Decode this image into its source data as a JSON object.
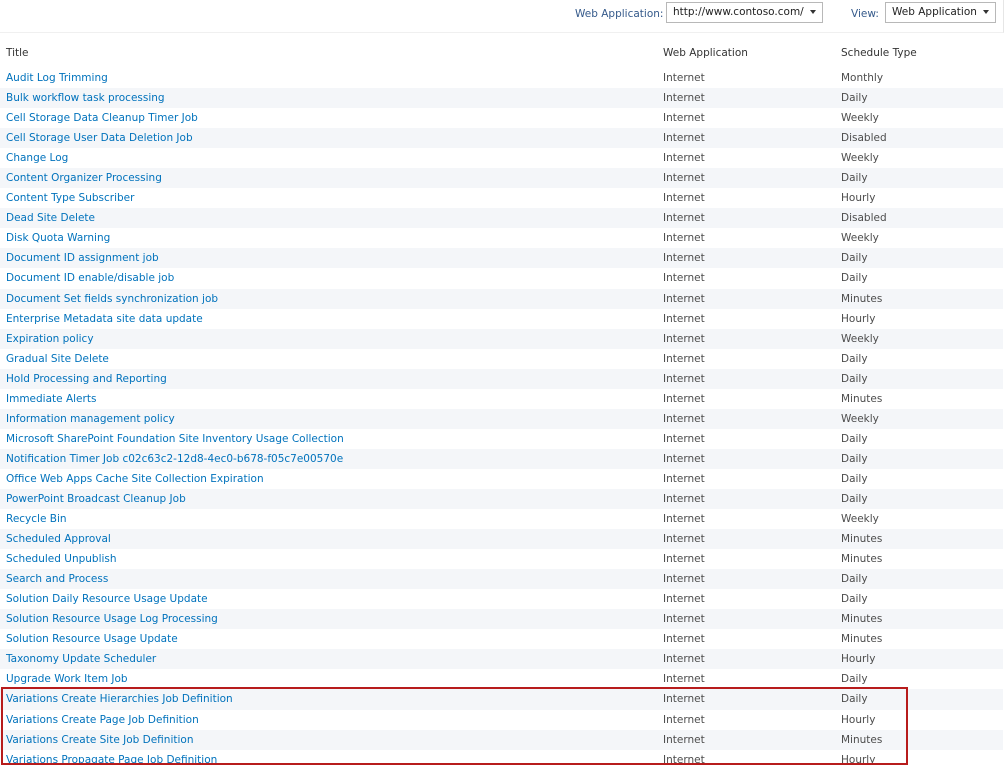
{
  "toolbar": {
    "web_application_label": "Web Application:",
    "web_application_value": "http://www.contoso.com/",
    "view_label": "View:",
    "view_value": "Web Application"
  },
  "table": {
    "columns": [
      "Title",
      "Web Application",
      "Schedule Type"
    ],
    "rows": [
      {
        "title": "Audit Log Trimming",
        "web_application": "Internet",
        "schedule_type": "Monthly"
      },
      {
        "title": "Bulk workflow task processing",
        "web_application": "Internet",
        "schedule_type": "Daily"
      },
      {
        "title": "Cell Storage Data Cleanup Timer Job",
        "web_application": "Internet",
        "schedule_type": "Weekly"
      },
      {
        "title": "Cell Storage User Data Deletion Job",
        "web_application": "Internet",
        "schedule_type": "Disabled"
      },
      {
        "title": "Change Log",
        "web_application": "Internet",
        "schedule_type": "Weekly"
      },
      {
        "title": "Content Organizer Processing",
        "web_application": "Internet",
        "schedule_type": "Daily"
      },
      {
        "title": "Content Type Subscriber",
        "web_application": "Internet",
        "schedule_type": "Hourly"
      },
      {
        "title": "Dead Site Delete",
        "web_application": "Internet",
        "schedule_type": "Disabled"
      },
      {
        "title": "Disk Quota Warning",
        "web_application": "Internet",
        "schedule_type": "Weekly"
      },
      {
        "title": "Document ID assignment job",
        "web_application": "Internet",
        "schedule_type": "Daily"
      },
      {
        "title": "Document ID enable/disable job",
        "web_application": "Internet",
        "schedule_type": "Daily"
      },
      {
        "title": "Document Set fields synchronization job",
        "web_application": "Internet",
        "schedule_type": "Minutes"
      },
      {
        "title": "Enterprise Metadata site data update",
        "web_application": "Internet",
        "schedule_type": "Hourly"
      },
      {
        "title": "Expiration policy",
        "web_application": "Internet",
        "schedule_type": "Weekly"
      },
      {
        "title": "Gradual Site Delete",
        "web_application": "Internet",
        "schedule_type": "Daily"
      },
      {
        "title": "Hold Processing and Reporting",
        "web_application": "Internet",
        "schedule_type": "Daily"
      },
      {
        "title": "Immediate Alerts",
        "web_application": "Internet",
        "schedule_type": "Minutes"
      },
      {
        "title": "Information management policy",
        "web_application": "Internet",
        "schedule_type": "Weekly"
      },
      {
        "title": "Microsoft SharePoint Foundation Site Inventory Usage Collection",
        "web_application": "Internet",
        "schedule_type": "Daily"
      },
      {
        "title": "Notification Timer Job c02c63c2-12d8-4ec0-b678-f05c7e00570e",
        "web_application": "Internet",
        "schedule_type": "Daily"
      },
      {
        "title": "Office Web Apps Cache Site Collection Expiration",
        "web_application": "Internet",
        "schedule_type": "Daily"
      },
      {
        "title": "PowerPoint Broadcast Cleanup Job",
        "web_application": "Internet",
        "schedule_type": "Daily"
      },
      {
        "title": "Recycle Bin",
        "web_application": "Internet",
        "schedule_type": "Weekly"
      },
      {
        "title": "Scheduled Approval",
        "web_application": "Internet",
        "schedule_type": "Minutes"
      },
      {
        "title": "Scheduled Unpublish",
        "web_application": "Internet",
        "schedule_type": "Minutes"
      },
      {
        "title": "Search and Process",
        "web_application": "Internet",
        "schedule_type": "Daily"
      },
      {
        "title": "Solution Daily Resource Usage Update",
        "web_application": "Internet",
        "schedule_type": "Daily"
      },
      {
        "title": "Solution Resource Usage Log Processing",
        "web_application": "Internet",
        "schedule_type": "Minutes"
      },
      {
        "title": "Solution Resource Usage Update",
        "web_application": "Internet",
        "schedule_type": "Minutes"
      },
      {
        "title": "Taxonomy Update Scheduler",
        "web_application": "Internet",
        "schedule_type": "Hourly"
      },
      {
        "title": "Upgrade Work Item Job",
        "web_application": "Internet",
        "schedule_type": "Daily"
      },
      {
        "title": "Variations Create Hierarchies Job Definition",
        "web_application": "Internet",
        "schedule_type": "Daily"
      },
      {
        "title": "Variations Create Page Job Definition",
        "web_application": "Internet",
        "schedule_type": "Hourly"
      },
      {
        "title": "Variations Create Site Job Definition",
        "web_application": "Internet",
        "schedule_type": "Minutes"
      },
      {
        "title": "Variations Propagate Page Job Definition",
        "web_application": "Internet",
        "schedule_type": "Hourly"
      }
    ]
  },
  "colors": {
    "link": "#0072bc",
    "label": "#34598a",
    "highlight_border": "#b71c1c"
  }
}
